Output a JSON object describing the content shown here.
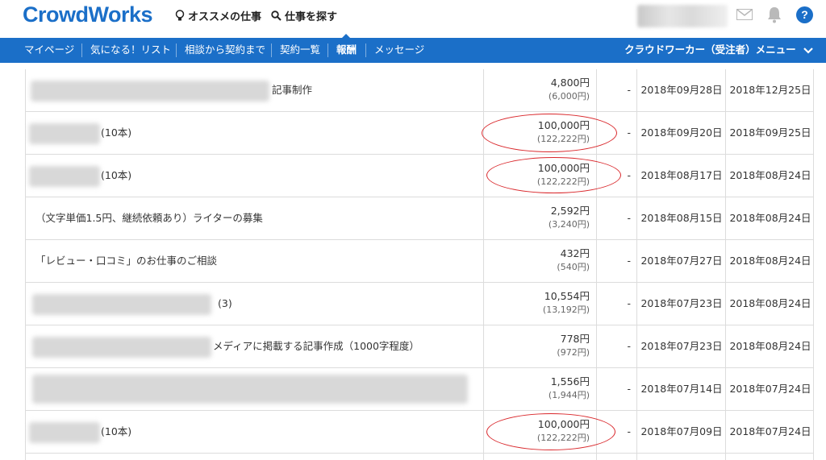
{
  "header": {
    "logo": "CrowdWorks",
    "recommended": "オススメの仕事",
    "find_job": "仕事を探す"
  },
  "nav": {
    "items": [
      "マイページ",
      "気になる！リスト",
      "相談から契約まで",
      "契約一覧",
      "報酬",
      "メッセージ"
    ],
    "active_index": 4,
    "menu": "クラウドワーカー（受注者）メニュー"
  },
  "rows": [
    {
      "title": "記事制作",
      "amount": "4,800円",
      "gross": "(6,000円)",
      "dash": "-",
      "date1": "2018年09月28日",
      "date2": "2018年12月25日",
      "circled": false
    },
    {
      "title": "(10本)",
      "amount": "100,000円",
      "gross": "(122,222円)",
      "dash": "-",
      "date1": "2018年09月20日",
      "date2": "2018年09月25日",
      "circled": true
    },
    {
      "title": "(10本)",
      "amount": "100,000円",
      "gross": "(122,222円)",
      "dash": "-",
      "date1": "2018年08月17日",
      "date2": "2018年08月24日",
      "circled": true
    },
    {
      "title": "（文字単価1.5円、継続依頼あり）ライターの募集",
      "amount": "2,592円",
      "gross": "(3,240円)",
      "dash": "-",
      "date1": "2018年08月15日",
      "date2": "2018年08月24日",
      "circled": false
    },
    {
      "title": "「レビュー・口コミ」のお仕事のご相談",
      "amount": "432円",
      "gross": "(540円)",
      "dash": "-",
      "date1": "2018年07月27日",
      "date2": "2018年08月24日",
      "circled": false
    },
    {
      "title": "(3)",
      "amount": "10,554円",
      "gross": "(13,192円)",
      "dash": "-",
      "date1": "2018年07月23日",
      "date2": "2018年08月24日",
      "circled": false
    },
    {
      "title": "メディアに掲載する記事作成（1000字程度）",
      "amount": "778円",
      "gross": "(972円)",
      "dash": "-",
      "date1": "2018年07月23日",
      "date2": "2018年08月24日",
      "circled": false
    },
    {
      "title": "",
      "amount": "1,556円",
      "gross": "(1,944円)",
      "dash": "-",
      "date1": "2018年07月14日",
      "date2": "2018年07月24日",
      "circled": false
    },
    {
      "title": "(10本)",
      "amount": "100,000円",
      "gross": "(122,222円)",
      "dash": "-",
      "date1": "2018年07月09日",
      "date2": "2018年07月24日",
      "circled": true
    }
  ]
}
